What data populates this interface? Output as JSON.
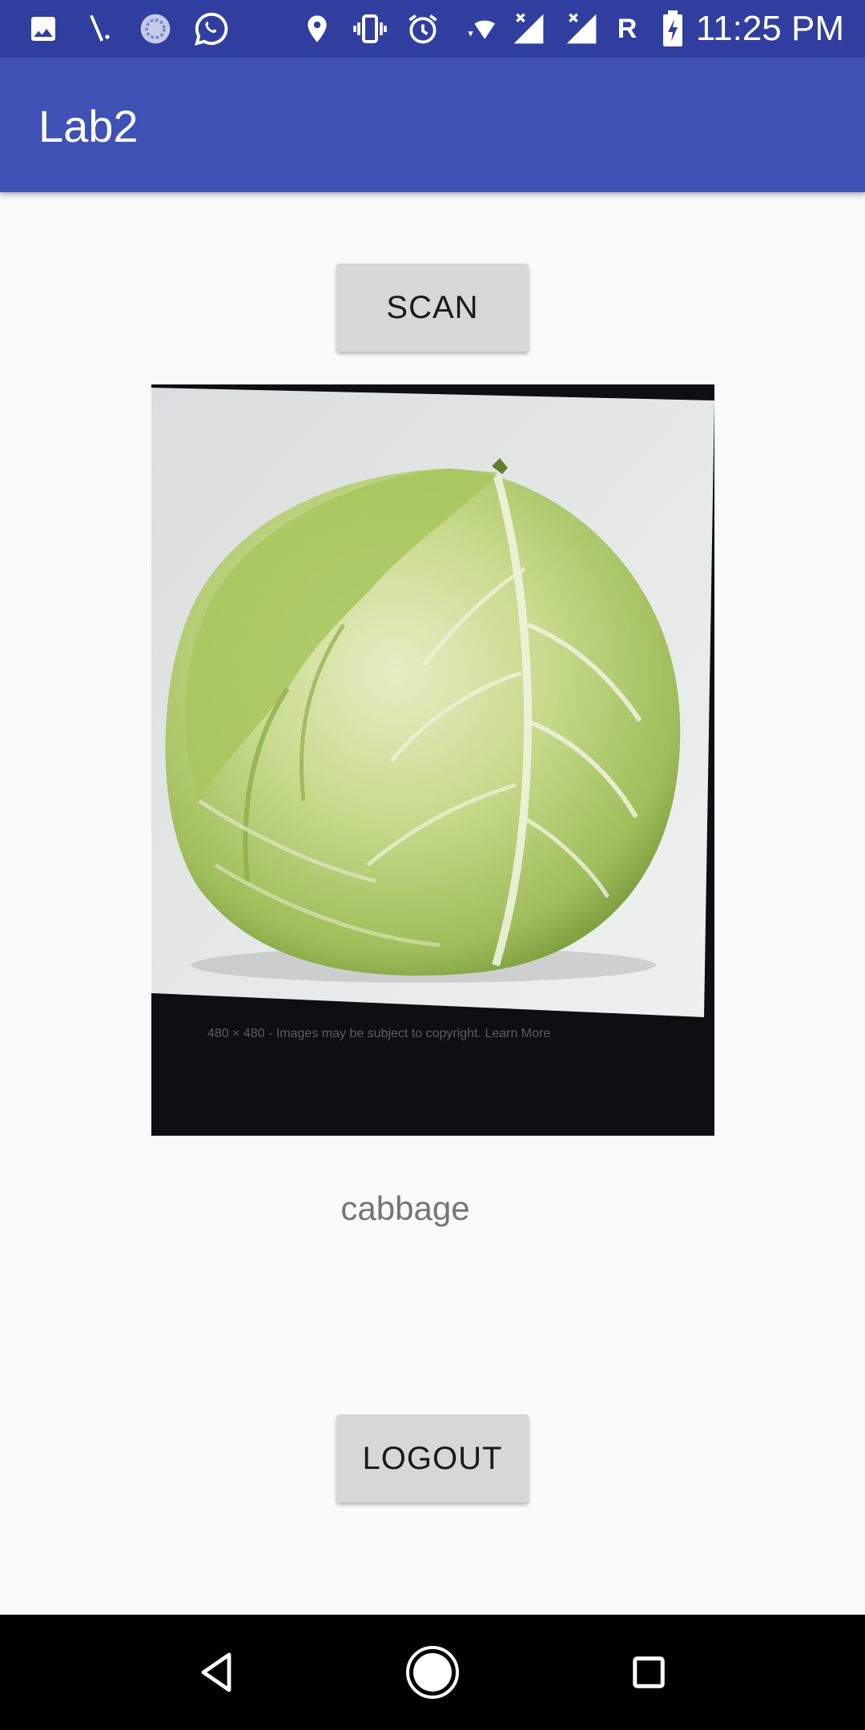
{
  "status_bar": {
    "time": "11:25 PM",
    "carrier_indicator": "R",
    "icons": [
      "image-icon",
      "signal-tool-icon",
      "sync-app-icon",
      "whatsapp-icon",
      "location-icon",
      "vibrate-icon",
      "alarm-icon",
      "wifi-icon",
      "cell-signal-icon",
      "cell-signal-icon",
      "battery-charging-icon"
    ]
  },
  "app_bar": {
    "title": "Lab2"
  },
  "main": {
    "scan_label": "SCAN",
    "photo_caption": "480 × 480 - Images may be subject to copyright. Learn More",
    "result": "cabbage",
    "logout_label": "LOGOUT"
  },
  "nav_bar": {
    "icons": [
      "back-icon",
      "home-icon",
      "recent-apps-icon"
    ]
  },
  "colors": {
    "status_bar": "#303f9f",
    "app_bar": "#3f51b5",
    "background": "#fafafa",
    "button": "#d6d7d7"
  }
}
